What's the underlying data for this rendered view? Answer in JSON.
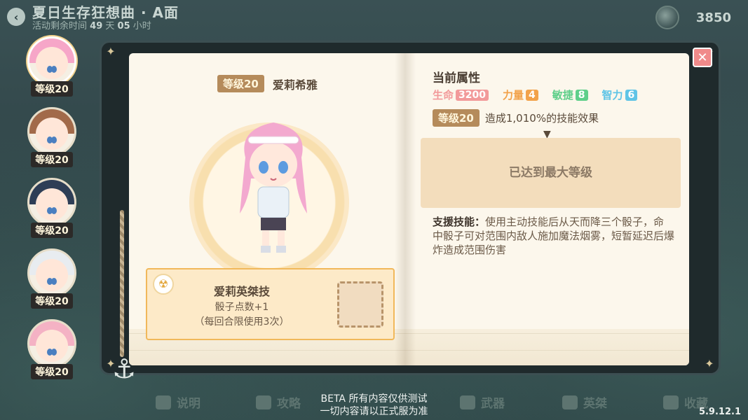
{
  "header": {
    "event_title": "夏日生存狂想曲 · A面",
    "countdown_prefix": "活动剩余时间",
    "countdown_days": "49",
    "days_unit": "天",
    "countdown_hours": "05",
    "hours_unit": "小时",
    "currency_value": "3850"
  },
  "characters": [
    {
      "level": "等级20",
      "hair": "#f6a6c8",
      "selected": true
    },
    {
      "level": "等级20",
      "hair": "#a26a4a",
      "selected": false
    },
    {
      "level": "等级20",
      "hair": "#2e3e56",
      "selected": false
    },
    {
      "level": "等级20",
      "hair": "#e8ecf0",
      "selected": false
    },
    {
      "level": "等级20",
      "hair": "#f4b2c4",
      "selected": false
    }
  ],
  "character_page": {
    "level": "等级20",
    "name": "爱莉希雅"
  },
  "skill": {
    "name": "爱莉英桀技",
    "line1": "骰子点数+1",
    "line2": "（每回合限使用3次）"
  },
  "attributes": {
    "title": "当前属性",
    "items": [
      {
        "label": "生命",
        "value": "3200",
        "color": "#f29a9a"
      },
      {
        "label": "力量",
        "value": "4",
        "color": "#f2a24a"
      },
      {
        "label": "敏捷",
        "value": "8",
        "color": "#5fcf8a"
      },
      {
        "label": "智力",
        "value": "6",
        "color": "#5fc4e6"
      }
    ],
    "effect_level": "等级20",
    "effect_text": "造成1,010%的技能效果",
    "max_level_text": "已达到最大等级"
  },
  "support": {
    "label": "支援技能：",
    "text": "使用主动技能后从天而降三个骰子，命中骰子可对范围内敌人施加魔法烟雾，短暂延迟后爆炸造成范围伤害"
  },
  "bottom_nav": [
    {
      "label": "说明"
    },
    {
      "label": "攻略"
    },
    {
      "label": "武器"
    },
    {
      "label": "英桀"
    },
    {
      "label": "收藏"
    }
  ],
  "footer": {
    "beta_line1": "BETA  所有内容仅供测试",
    "beta_line2": "一切内容请以正式服为准",
    "version": "5.9.12.1"
  },
  "icons": {
    "back": "back-arrow-icon",
    "close": "close-icon",
    "coin": "coin-icon",
    "anchor": "anchor-icon"
  }
}
